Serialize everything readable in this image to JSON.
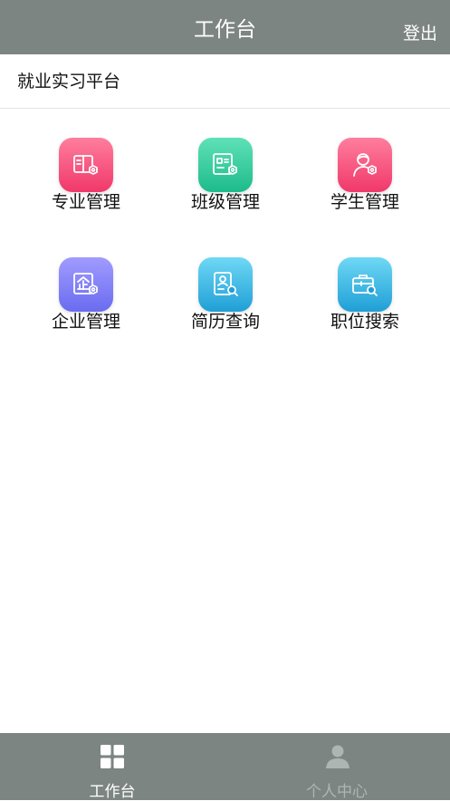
{
  "header": {
    "title": "工作台",
    "logout_label": "登出"
  },
  "subbar": {
    "title": "就业实习平台"
  },
  "tiles": [
    {
      "label": "专业管理",
      "icon": "book-gear-icon",
      "color_top": "#ff7e9d",
      "color_bottom": "#f0386a"
    },
    {
      "label": "班级管理",
      "icon": "class-gear-icon",
      "color_top": "#5fe1b7",
      "color_bottom": "#1dbb8b"
    },
    {
      "label": "学生管理",
      "icon": "student-gear-icon",
      "color_top": "#ff7e9d",
      "color_bottom": "#f0386a"
    },
    {
      "label": "企业管理",
      "icon": "enterprise-gear-icon",
      "color_top": "#a19bff",
      "color_bottom": "#6a6cf0"
    },
    {
      "label": "简历查询",
      "icon": "resume-search-icon",
      "color_top": "#6fd8f5",
      "color_bottom": "#1f9fd6"
    },
    {
      "label": "职位搜索",
      "icon": "briefcase-search-icon",
      "color_top": "#6fd8f5",
      "color_bottom": "#1f9fd6"
    }
  ],
  "bottom_nav": {
    "items": [
      {
        "label": "工作台",
        "icon": "grid-icon",
        "active": true
      },
      {
        "label": "个人中心",
        "icon": "person-icon",
        "active": false
      }
    ]
  },
  "colors": {
    "bar": "#7d8582",
    "nav_inactive": "#aeb5b2"
  }
}
